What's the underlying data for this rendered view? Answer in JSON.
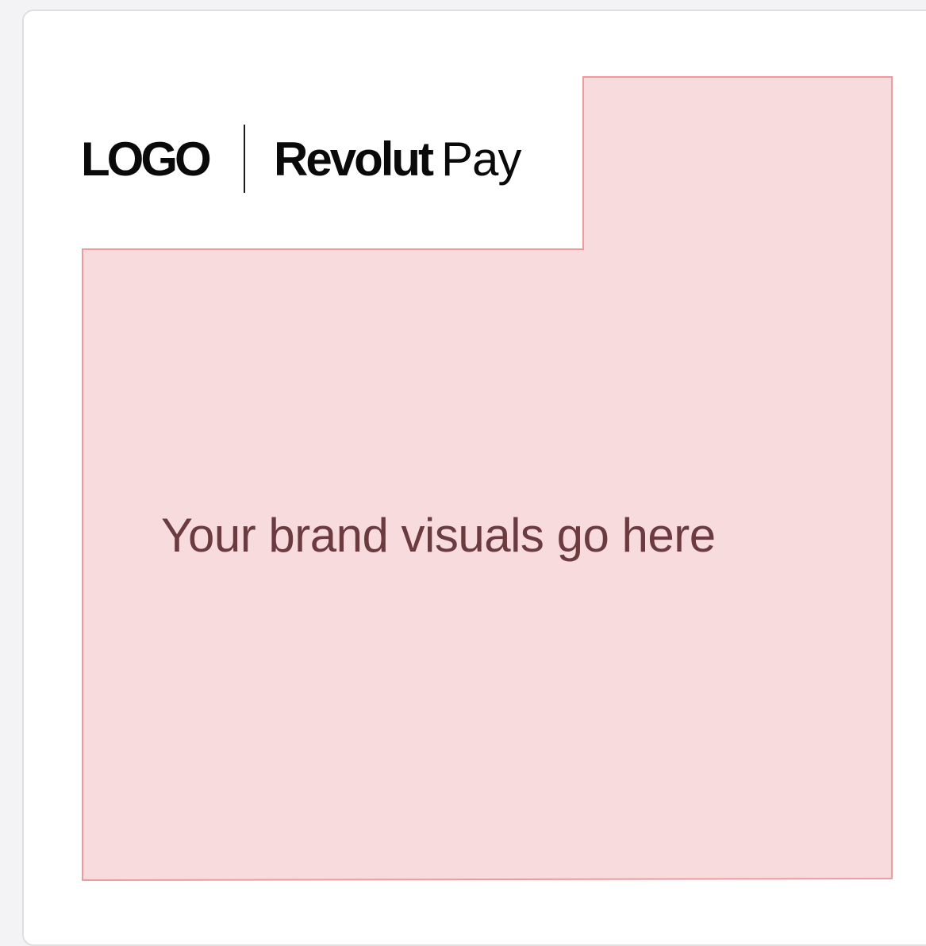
{
  "header": {
    "merchant_logo_text": "LOGO",
    "revolut_word": "Revolut",
    "pay_word": "Pay"
  },
  "placeholder": {
    "text": "Your brand visuals go here",
    "fill_color": "#f8dcdd",
    "border_color": "#ee9a9e",
    "text_color": "#6b3b40"
  },
  "colors": {
    "page_background": "#f3f3f5",
    "card_background": "#ffffff",
    "logo_color": "#0a0a0a"
  }
}
